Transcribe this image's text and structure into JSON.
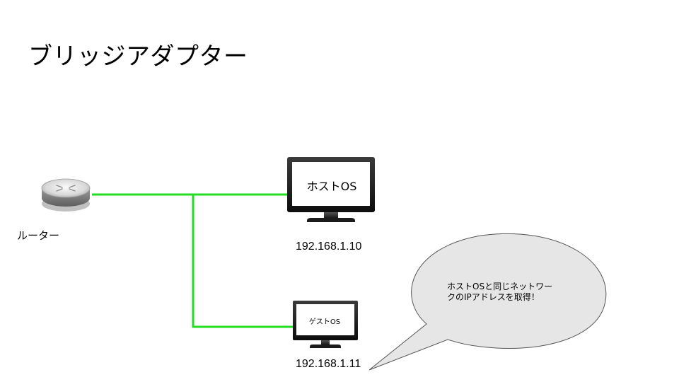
{
  "slide": {
    "title": "ブリッジアダプター"
  },
  "router": {
    "label": "ルーター",
    "icon": "router-icon"
  },
  "host": {
    "screen_label": "ホストOS",
    "ip": "192.168.1.10",
    "icon": "monitor-icon"
  },
  "guest": {
    "screen_label": "ゲストOS",
    "ip": "192.168.1.11",
    "icon": "monitor-icon"
  },
  "callout": {
    "line1": "ホストOSと同じネットワー",
    "line2": "クのIPアドレスを取得！"
  },
  "colors": {
    "connection": "#22dd22",
    "bubble_fill": "#e6e6e6",
    "bubble_stroke": "#555555",
    "monitor_frame": "#1a1a1a"
  }
}
